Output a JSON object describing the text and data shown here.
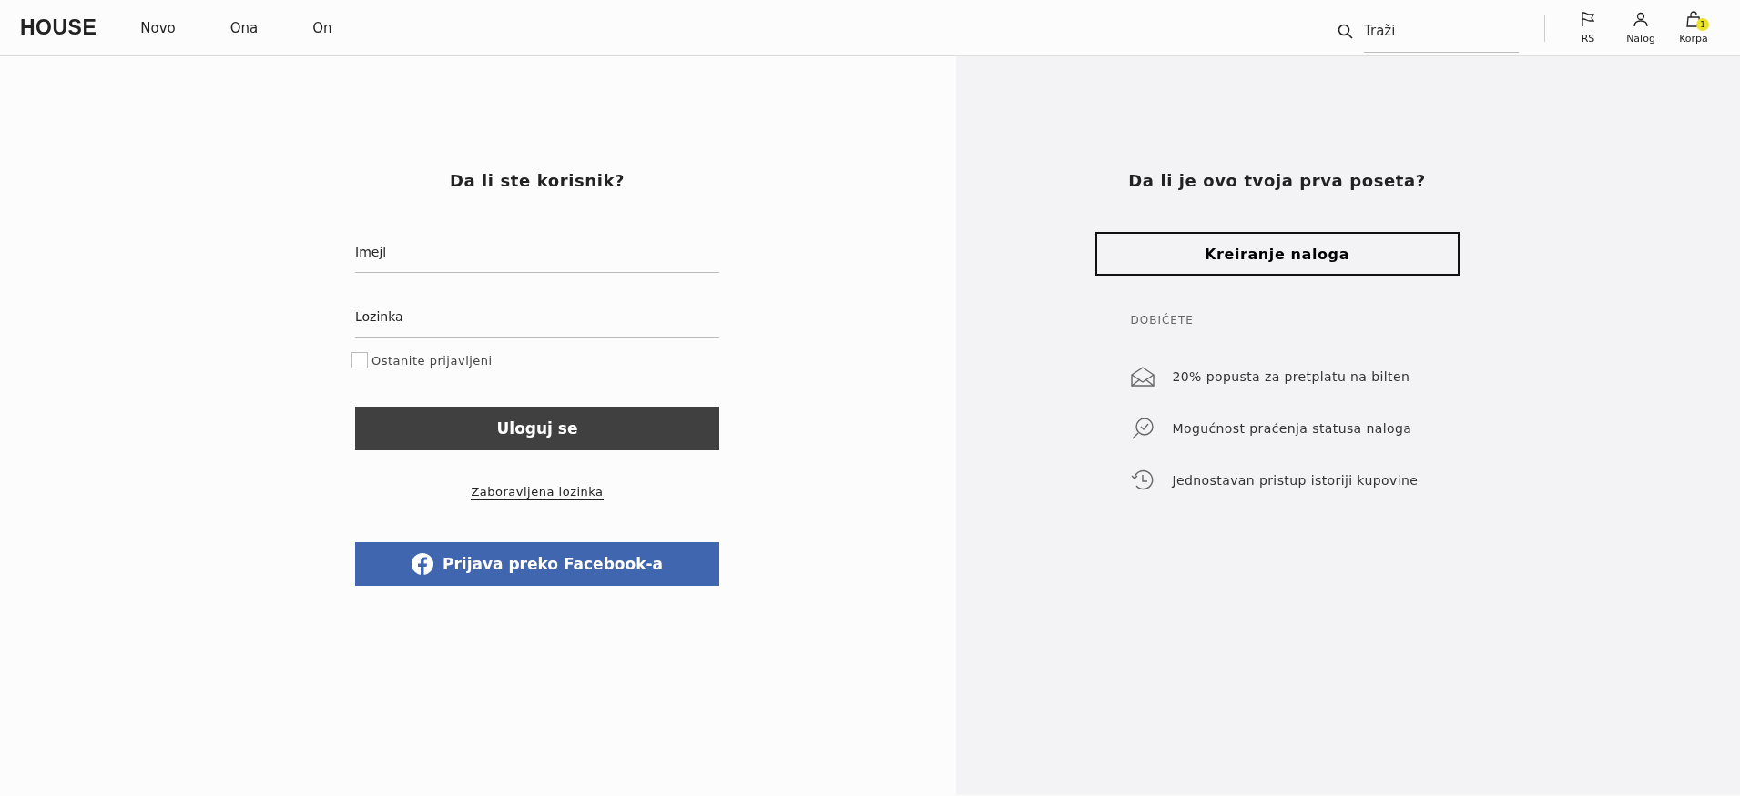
{
  "header": {
    "logo": "HOUSE",
    "nav": [
      "Novo",
      "Ona",
      "On"
    ],
    "search": {
      "placeholder": "Traži"
    },
    "actions": [
      {
        "kind": "flag",
        "label": "RS"
      },
      {
        "kind": "user",
        "label": "Nalog"
      },
      {
        "kind": "bag",
        "label": "Korpa",
        "badge": "1"
      }
    ]
  },
  "login": {
    "title": "Da li ste korisnik?",
    "fields": [
      {
        "placeholder": "Imejl"
      },
      {
        "placeholder": "Lozinka"
      }
    ],
    "remember": {
      "label": "Ostanite prijavljeni",
      "checked": false
    },
    "submit": "Uloguj se",
    "forgot": "Zaboravljena lozinka",
    "facebook": "Prijava preko Facebook-a"
  },
  "register": {
    "title": "Da li je ovo tvoja prva poseta?",
    "button": "Kreiranje naloga",
    "benefits_title": "DOBIĆETE",
    "benefits": [
      {
        "kind": "envelope",
        "text": "20% popusta za pretplatu na bilten"
      },
      {
        "kind": "check",
        "text": "Mogućnost praćenja statusa naloga"
      },
      {
        "kind": "history",
        "text": "Jednostavan pristup istoriji kupovine"
      }
    ]
  }
}
